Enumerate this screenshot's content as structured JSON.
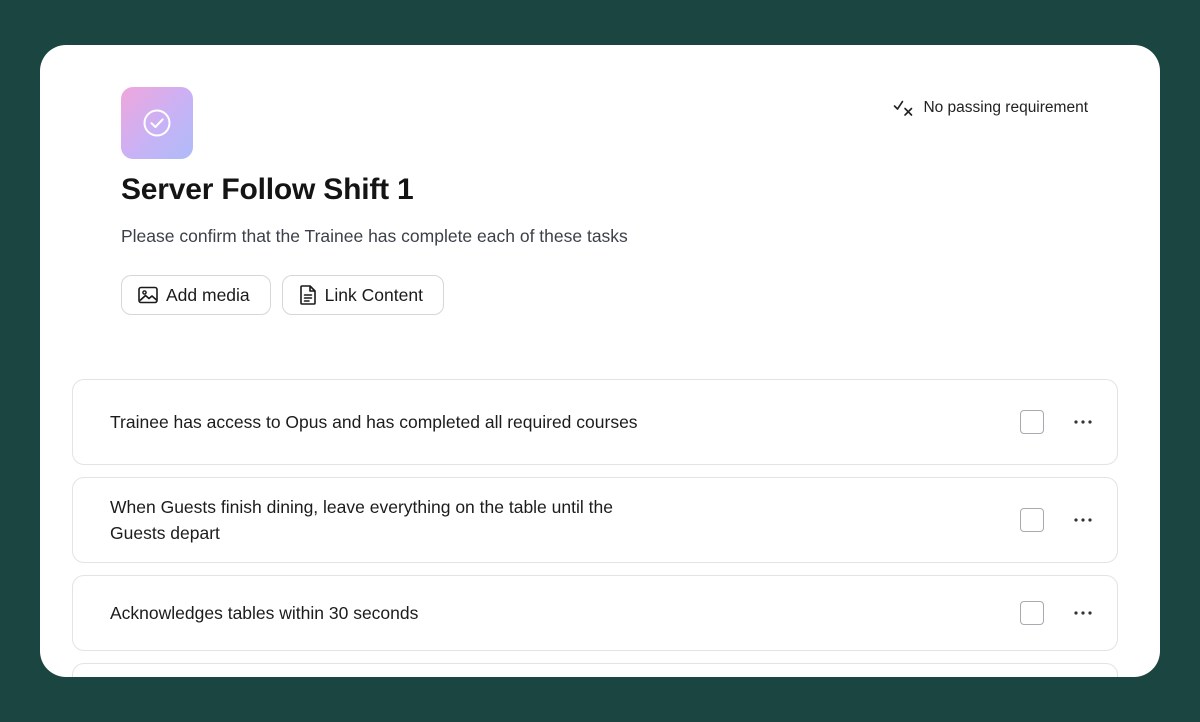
{
  "card": {
    "title": "Server Follow Shift 1",
    "description": "Please confirm that the Trainee has complete each of these tasks",
    "passing_requirement": "No passing requirement",
    "badge_icon": "check-circle-icon",
    "badge_colors": [
      "#f0a6dc",
      "#aebcf8"
    ]
  },
  "actions": {
    "add_media_label": "Add media",
    "add_media_icon": "image-icon",
    "link_content_label": "Link Content",
    "link_content_icon": "document-icon"
  },
  "tasks": [
    {
      "text": "Trainee has access to Opus and has completed all required courses",
      "checked": false
    },
    {
      "text": "When Guests finish dining, leave everything on the table until the Guests depart",
      "checked": false
    },
    {
      "text": "Acknowledges tables within 30 seconds",
      "checked": false
    }
  ],
  "colors": {
    "background": "#1b4540",
    "card": "#ffffff"
  }
}
